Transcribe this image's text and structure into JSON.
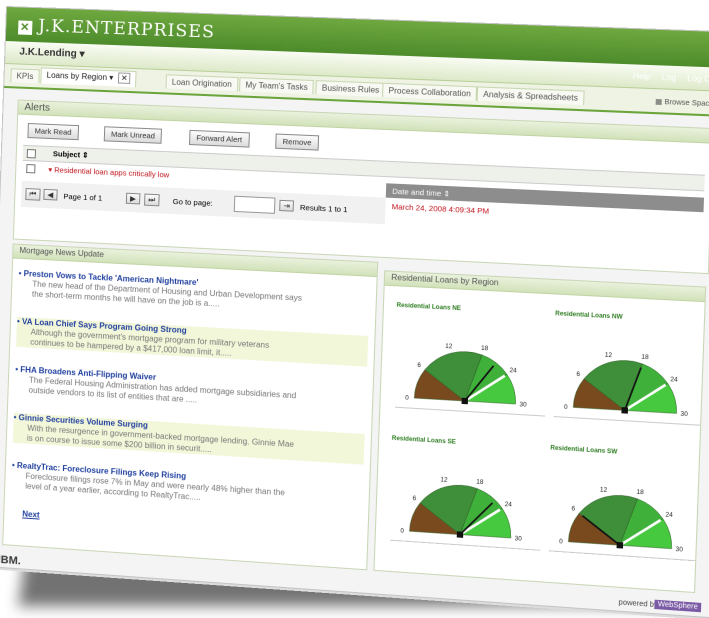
{
  "brand": {
    "name": "J.K.ENTERPRISES"
  },
  "lender": {
    "name": "J.K.Lending"
  },
  "tabs": [
    {
      "label": "KPIs"
    },
    {
      "label": "Loans by Region"
    },
    {
      "label": "Loan Origination"
    },
    {
      "label": "My Team's Tasks"
    },
    {
      "label": "Business Rules"
    },
    {
      "label": "Process Collaboration"
    },
    {
      "label": "Analysis & Spreadsheets"
    }
  ],
  "header_links": [
    "Help",
    "Log",
    "Log Out"
  ],
  "browse": "Browse Spaces",
  "alerts": {
    "title": "Alerts",
    "buttons": [
      "Mark Read",
      "Mark Unread",
      "Forward Alert",
      "Remove"
    ],
    "col_subject": "Subject",
    "col_date": "Date and time",
    "row_subject": "Residential loan apps critically low",
    "row_date": "March 24, 2008 4:09:34 PM",
    "page": "Page 1 of 1",
    "goto": "Go to page:",
    "results": "Results 1 to 1"
  },
  "news": {
    "title": "Mortgage News Update",
    "items": [
      {
        "title": "Preston Vows to Tackle 'American Nightmare'",
        "desc": "The new head of the Department of Housing and Urban Development says the short-term months he will have on the job is a....."
      },
      {
        "title": "VA Loan Chief Says Program Going Strong",
        "desc": "Although the government's mortgage program for military veterans continues to be hampered by a $417,000 loan limit, it....."
      },
      {
        "title": "FHA Broadens Anti-Flipping Waiver",
        "desc": "The Federal Housing Administration has added mortgage subsidiaries and outside vendors to its list of entities that are ....."
      },
      {
        "title": "Ginnie Securities Volume Surging",
        "desc": "With the resurgence in government-backed mortgage lending, Ginnie Mae is on course to issue some $200 billion in securit....."
      },
      {
        "title": "RealtyTrac: Foreclosure Filings Keep Rising",
        "desc": "Foreclosure filings rose 7% in May and were nearly 48% higher than the level of a year earlier, according to RealtyTrac....."
      }
    ],
    "next": "Next"
  },
  "gauges_panel": {
    "title": "Residential Loans by Region"
  },
  "colors": {
    "brand": "#4d8b2b",
    "alert": "#c0121a",
    "link": "#1f3f9e",
    "gauge_brown": "#7a4a1f",
    "gauge_green": "#3e8e3a",
    "gauge_light": "#46c93f"
  },
  "chart_data": [
    {
      "type": "gauge",
      "title": "Residential Loans NE",
      "ticks": [
        "0",
        "6",
        "12",
        "18",
        "24",
        "30"
      ],
      "range": [
        0,
        30
      ],
      "value": 21
    },
    {
      "type": "gauge",
      "title": "Residential Loans NW",
      "ticks": [
        "0",
        "6",
        "12",
        "18",
        "24",
        "30"
      ],
      "range": [
        0,
        30
      ],
      "value": 18
    },
    {
      "type": "gauge",
      "title": "Residential Loans SE",
      "ticks": [
        "0",
        "6",
        "12",
        "18",
        "24",
        "30"
      ],
      "range": [
        0,
        30
      ],
      "value": 22
    },
    {
      "type": "gauge",
      "title": "Residential Loans SW",
      "ticks": [
        "0",
        "6",
        "12",
        "18",
        "24",
        "30"
      ],
      "range": [
        0,
        30
      ],
      "value": 6
    }
  ],
  "footer": {
    "ibm": "IBM.",
    "powered": "powered by",
    "ws": "WebSphere"
  }
}
